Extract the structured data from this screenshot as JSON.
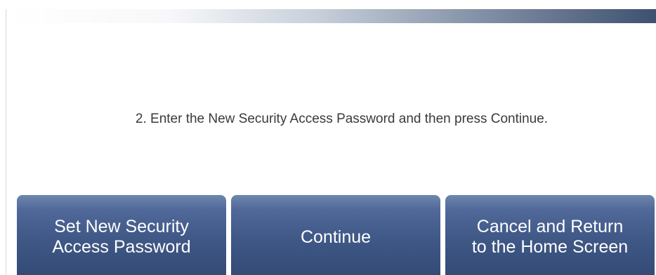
{
  "instruction": "2. Enter the New Security Access Password and then press Continue.",
  "buttons": {
    "set_new_password": "Set New Security\nAccess Password",
    "continue": "Continue",
    "cancel_return_home": "Cancel and Return\nto the Home Screen"
  },
  "colors": {
    "button_blue": "#3f5886",
    "header_dark": "#3f5170"
  }
}
